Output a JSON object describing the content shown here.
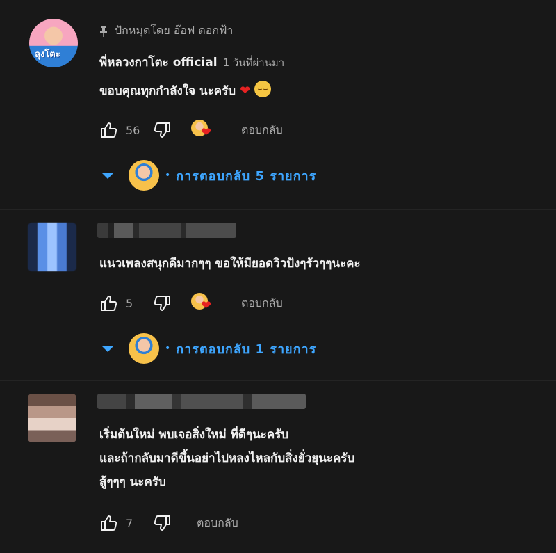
{
  "comments": [
    {
      "pinned_label": "ปักหมุดโดย อ๊อฟ ดอกฟ้า",
      "author": "พี่หลวงกาโตะ official",
      "timestamp": "1 วันที่ผ่านมา",
      "avatar_text": "ลุงโตะ",
      "text_lines": [
        "ขอบคุณทุกกำลังใจ นะครับ"
      ],
      "likes": "56",
      "reply_label": "ตอบกลับ",
      "replies_label": "การตอบกลับ 5 รายการ"
    },
    {
      "text_lines": [
        "แนวเพลงสนุกดีมากๆๆ ขอให้มียอดวิวปังๆรัวๆๆนะคะ"
      ],
      "likes": "5",
      "reply_label": "ตอบกลับ",
      "replies_label": "การตอบกลับ 1 รายการ"
    },
    {
      "text_lines": [
        "เริ่มต้นใหม่ พบเจอสิ่งใหม่ ที่ดีๆนะครับ",
        "และถ้ากลับมาดีขึ้นอย่าไปหลงไหลกับสิ่งยั่วยุนะครับ",
        "สู้ๆๆๆ นะครับ"
      ],
      "likes": "7",
      "reply_label": "ตอบกลับ"
    }
  ],
  "colors": {
    "background": "#181818",
    "text": "#f1f1f1",
    "secondary": "#aaaaaa",
    "link_blue": "#3ea6ff",
    "heart_red": "#e62222"
  },
  "icons": [
    "pin-icon",
    "like-icon",
    "dislike-icon",
    "creator-heart-icon",
    "chevron-down-icon",
    "heart-emoji-icon",
    "pleading-face-emoji-icon"
  ]
}
